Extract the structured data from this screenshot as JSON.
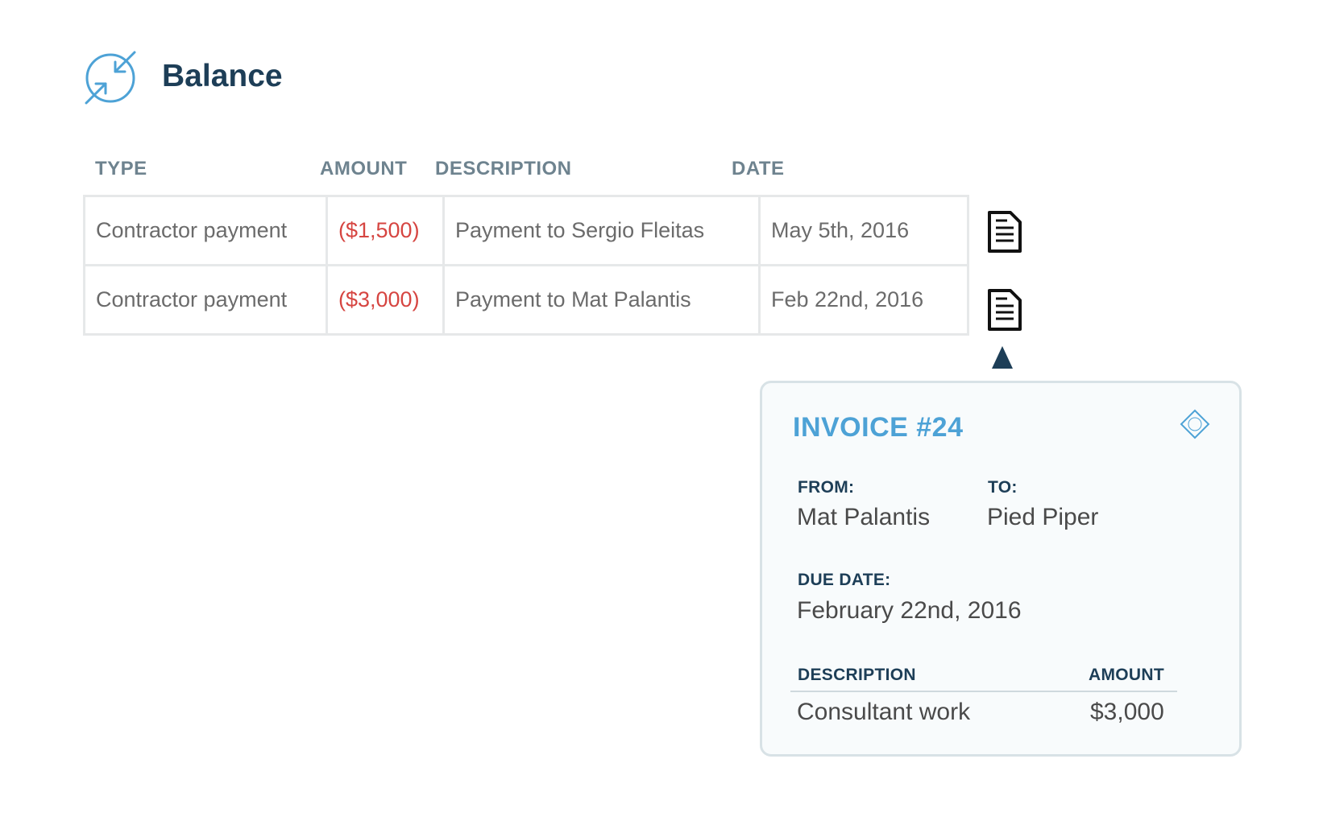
{
  "header": {
    "title": "Balance",
    "icon": "transfer-arrows-icon"
  },
  "table": {
    "columns": [
      "TYPE",
      "AMOUNT",
      "DESCRIPTION",
      "DATE"
    ],
    "rows": [
      {
        "type": "Contractor payment",
        "amount": "($1,500)",
        "description": "Payment to Sergio Fleitas",
        "date": "May 5th, 2016"
      },
      {
        "type": "Contractor payment",
        "amount": "($3,000)",
        "description": "Payment to Mat Palantis",
        "date": "Feb 22nd, 2016"
      }
    ],
    "row_action_icon": "document-icon"
  },
  "invoice": {
    "title": "INVOICE #24",
    "close_icon": "diamond-close-icon",
    "from_label": "FROM:",
    "from_value": "Mat Palantis",
    "to_label": "TO:",
    "to_value": "Pied Piper",
    "due_label": "DUE DATE:",
    "due_value": "February 22nd, 2016",
    "desc_header": "DESCRIPTION",
    "amount_header": "AMOUNT",
    "items": [
      {
        "description": "Consultant work",
        "amount": "$3,000"
      }
    ]
  },
  "colors": {
    "title": "#1d3e57",
    "header_text": "#6e838f",
    "negative_amount": "#d64541",
    "invoice_accent": "#4da2d6",
    "card_border": "#d8e2e6"
  }
}
